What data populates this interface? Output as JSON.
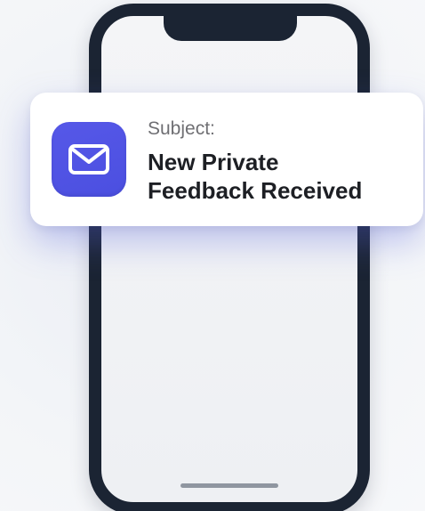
{
  "colors": {
    "background": "#f3f5f8",
    "phone_frame": "#1b2433",
    "phone_screen": "#f1f2f4",
    "mail_icon_bg": "#5658e8",
    "mail_icon_fg": "#ffffff",
    "notification_bg": "#ffffff",
    "label_text": "#6f6f73",
    "subject_text": "#1d1f24",
    "glow": "#5a64dc"
  },
  "notification": {
    "icon": "mail-icon",
    "label": "Subject:",
    "subject_lines": [
      "New Private",
      "Feedback Received"
    ]
  }
}
